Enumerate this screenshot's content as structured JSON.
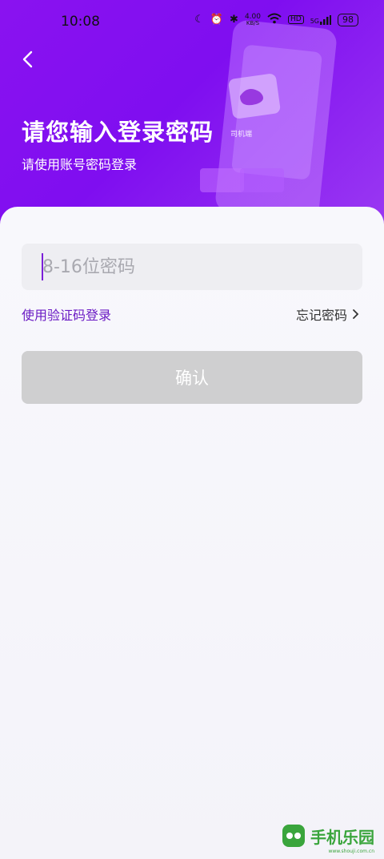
{
  "status_bar": {
    "time": "10:08",
    "net_speed": "4.00",
    "net_unit": "KB/S",
    "hd": "HD",
    "signal": "5G",
    "battery": "98"
  },
  "header": {
    "title": "请您输入登录密码",
    "subtitle": "请使用账号密码登录",
    "illustration_label": "司机端"
  },
  "form": {
    "password_placeholder": "8-16位密码",
    "password_value": "",
    "code_login_label": "使用验证码登录",
    "forgot_label": "忘记密码",
    "confirm_label": "确认"
  },
  "watermark": {
    "text": "手机乐园",
    "url": "www.shouji.com.cn"
  },
  "colors": {
    "header_purple": "#8a12f0",
    "link_purple": "#6a1ac4",
    "button_disabled": "#cfcfd0"
  }
}
